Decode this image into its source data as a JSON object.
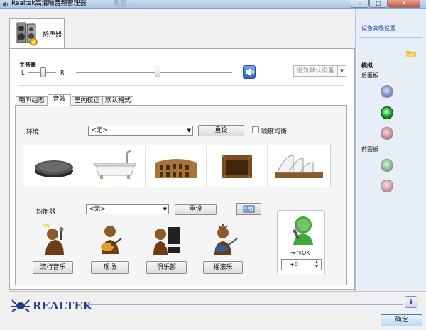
{
  "window": {
    "title": "Realtek高清晰音频管理器",
    "ghost_text": "版面 ..."
  },
  "titlebar_buttons": {
    "minimize": "–",
    "maximize": "□",
    "close": "✕"
  },
  "device_tab": {
    "label": "扬声器",
    "icon": "speaker-icon"
  },
  "main_volume": {
    "label": "主音量",
    "left": "L",
    "right": "R",
    "balance_level": 0.5,
    "volume_level": 0.5
  },
  "default_device": {
    "label": "设为默认设备",
    "arrow": "▼"
  },
  "tabs": [
    {
      "label": "喇叭组态"
    },
    {
      "label": "音效"
    },
    {
      "label": "室内校正"
    },
    {
      "label": "默认格式"
    }
  ],
  "environment": {
    "label": "环境",
    "value": "<无>",
    "arrow": "▼",
    "reset": "重设",
    "loudness_label": "响度均衡"
  },
  "env_images": [
    "stone-disc-icon",
    "bathtub-icon",
    "colosseum-icon",
    "wooden-room-icon",
    "opera-house-icon"
  ],
  "equalizer": {
    "label": "均衡器",
    "value": "<无>",
    "arrow": "▼",
    "reset": "重设",
    "graph_icon": "eq-graph-icon"
  },
  "presets": [
    {
      "label": "流行音乐",
      "icon": "pop-singer-icon"
    },
    {
      "label": "现场",
      "icon": "guitarist-icon"
    },
    {
      "label": "俱乐部",
      "icon": "pianist-icon"
    },
    {
      "label": "摇滚乐",
      "icon": "rock-guitarist-icon"
    }
  ],
  "karaoke": {
    "label": "卡拉OK",
    "value": "+0",
    "up": "▲",
    "down": "▼",
    "icon": "karaoke-mic-icon"
  },
  "right_panel": {
    "advanced_link": "设备高级设置",
    "analog_label": "模拟",
    "rear_label": "后面板",
    "front_label": "前面板",
    "colors": {
      "blue": "#7c8fc5",
      "green": "#18a02c",
      "pink": "#cc8a96"
    }
  },
  "footer": {
    "brand": "REALTEK",
    "info": "i",
    "ok": "确定"
  }
}
